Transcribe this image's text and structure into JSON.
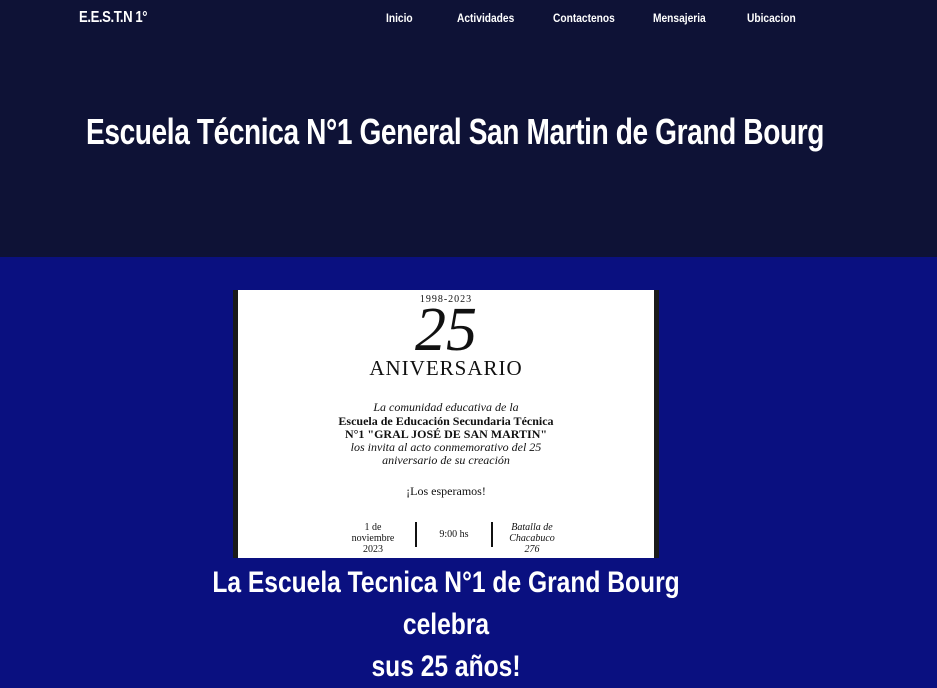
{
  "brand": "E.E.S.T.N 1°",
  "nav": {
    "items": [
      "Inicio",
      "Actividades",
      "Contactenos",
      "Mensajeria",
      "Ubicacion"
    ]
  },
  "hero": {
    "title": "Escuela Técnica N°1 General San Martin de Grand Bourg"
  },
  "flyer": {
    "years": "1998-2023",
    "number": "25",
    "aniversario": "ANIVERSARIO",
    "line1": "La comunidad educativa de la",
    "line2": "Escuela de Educación Secundaria Técnica",
    "line3": "N°1 \"GRAL JOSÉ DE SAN MARTIN\"",
    "line4": "los invita al acto conmemorativo del 25",
    "line5": "aniversario de su creación",
    "closing": "¡Los esperamos!",
    "date_1": "1 de",
    "date_2": "noviembre",
    "date_3": "2023",
    "time": "9:00 hs",
    "place_1": "Batalla de",
    "place_2": "Chacabuco",
    "place_3": "276"
  },
  "article": {
    "headline_1": "La Escuela Tecnica N°1 de Grand Bourg celebra",
    "headline_2": "sus 25 años!"
  },
  "colors": {
    "hero_bg": "#0e1236",
    "content_bg": "#0a1080",
    "text": "#ffffff"
  }
}
